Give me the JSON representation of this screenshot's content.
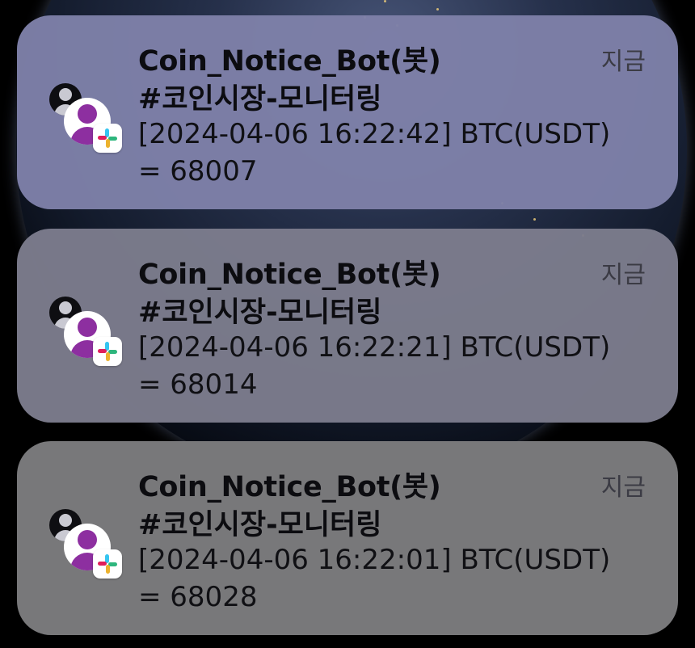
{
  "notifications": [
    {
      "title": "Coin_Notice_Bot(봇)",
      "channel": "#코인시장-모니터링",
      "message_line1": "[2024-04-06 16:22:42] BTC(USDT)",
      "message_line2": "=  68007",
      "time": "지금",
      "icon": "slack-icon"
    },
    {
      "title": "Coin_Notice_Bot(봇)",
      "channel": "#코인시장-모니터링",
      "message_line1": "[2024-04-06 16:22:21] BTC(USDT)",
      "message_line2": "=  68014",
      "time": "지금",
      "icon": "slack-icon"
    },
    {
      "title": "Coin_Notice_Bot(봇)",
      "channel": "#코인시장-모니터링",
      "message_line1": "[2024-04-06 16:22:01] BTC(USDT)",
      "message_line2": "=  68028",
      "time": "지금",
      "icon": "slack-icon"
    }
  ],
  "colors": {
    "avatar_purple": "#8d2fa0",
    "slack_red": "#e01e5a",
    "slack_green": "#2eb67d",
    "slack_yellow": "#ecb22e",
    "slack_blue": "#36c5f0"
  }
}
